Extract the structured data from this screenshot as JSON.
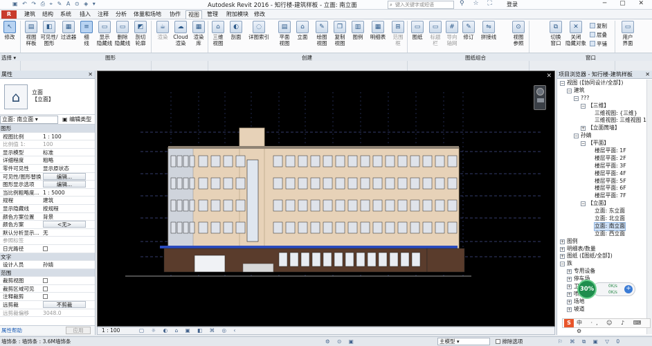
{
  "titlebar": {
    "title": "Autodesk Revit 2016 -   知行楼-建筑样板 - 立面: 南立面",
    "search_placeholder": "键入关键字或短语",
    "login": "登录",
    "window_buttons": "─ ▢ ✕"
  },
  "menubar": {
    "app_button": "R",
    "tabs": [
      "建筑",
      "结构",
      "系统",
      "插入",
      "注释",
      "分析",
      "体量和场地",
      "协作",
      "视图",
      "管理",
      "附加模块",
      "修改"
    ],
    "active_tab": "视图"
  },
  "ribbon": {
    "modify": "修改",
    "buttons": [
      {
        "label": "视图\n样板",
        "icon": "view-template-icon"
      },
      {
        "label": "可见性/\n图形",
        "icon": "visibility-icon"
      },
      {
        "label": "过滤器",
        "icon": "filter-icon"
      },
      {
        "label": "细\n线",
        "icon": "thin-lines-icon"
      },
      {
        "label": "显示\n隐藏线",
        "icon": "show-hidden-icon"
      },
      {
        "label": "删除\n隐藏线",
        "icon": "remove-hidden-icon"
      },
      {
        "label": "剖切\n轮廓",
        "icon": "cut-profile-icon"
      },
      {
        "label": "渲染",
        "icon": "render-icon"
      },
      {
        "label": "Cloud\n渲染",
        "icon": "cloud-render-icon"
      },
      {
        "label": "渲染\n库",
        "icon": "render-gallery-icon"
      },
      {
        "label": "三维\n视图",
        "icon": "3d-view-icon"
      },
      {
        "label": "剖面",
        "icon": "section-icon"
      },
      {
        "label": "详图索引",
        "icon": "callout-icon"
      },
      {
        "label": "平面\n视图",
        "icon": "plan-view-icon"
      },
      {
        "label": "立面",
        "icon": "elevation-icon"
      },
      {
        "label": "绘图\n视图",
        "icon": "drafting-view-icon"
      },
      {
        "label": "复制\n视图",
        "icon": "duplicate-view-icon"
      },
      {
        "label": "图例",
        "icon": "legend-icon"
      },
      {
        "label": "明细表",
        "icon": "schedule-icon"
      },
      {
        "label": "范围\n框",
        "icon": "scope-box-icon"
      },
      {
        "label": "图纸",
        "icon": "sheet-icon"
      },
      {
        "label": "标题\n栏",
        "icon": "title-block-icon"
      },
      {
        "label": "导向\n轴网",
        "icon": "guide-grid-icon"
      },
      {
        "label": "修订",
        "icon": "revisions-icon"
      },
      {
        "label": "拼接线",
        "icon": "matchline-icon"
      },
      {
        "label": "视图\n参照",
        "icon": "view-reference-icon"
      },
      {
        "label": "切换\n窗口",
        "icon": "switch-windows-icon"
      },
      {
        "label": "关闭\n隐藏对象",
        "icon": "close-hidden-icon"
      }
    ],
    "small_buttons": [
      "复制",
      "层叠",
      "平铺"
    ],
    "ui_button": "用户\n界面",
    "panels": [
      "选择 ▾",
      "图形",
      "创建",
      "图纸组合",
      "窗口"
    ]
  },
  "properties": {
    "title": "属性",
    "type_name": "立面",
    "type_sub": "【立面】",
    "type_selector": "立面: 南立面",
    "edit_type": "编辑类型",
    "rows": [
      {
        "k": "图形",
        "v": "",
        "group": true
      },
      {
        "k": "视图比例",
        "v": "1 : 100"
      },
      {
        "k": "比例值 1:",
        "v": "100",
        "gray": true
      },
      {
        "k": "显示模型",
        "v": "标准"
      },
      {
        "k": "详细程度",
        "v": "粗略"
      },
      {
        "k": "零件可见性",
        "v": "显示原状态"
      },
      {
        "k": "可见性/图形替换",
        "v": "编辑...",
        "btn": true
      },
      {
        "k": "图形显示选项",
        "v": "编辑...",
        "btn": true
      },
      {
        "k": "当比例粗略度...",
        "v": "1 : 5000"
      },
      {
        "k": "规程",
        "v": "建筑"
      },
      {
        "k": "显示隐藏线",
        "v": "按规程"
      },
      {
        "k": "颜色方案位置",
        "v": "背景"
      },
      {
        "k": "颜色方案",
        "v": "<无>",
        "btn": true
      },
      {
        "k": "默认分析显示...",
        "v": "无"
      },
      {
        "k": "参照标签",
        "v": "",
        "gray": true
      },
      {
        "k": "日光路径",
        "v": "",
        "check": true
      },
      {
        "k": "文字",
        "v": "",
        "group": true
      },
      {
        "k": "设计人员",
        "v": "孙婧"
      },
      {
        "k": "范围",
        "v": "",
        "group": true
      },
      {
        "k": "裁剪视图",
        "v": "",
        "check": true
      },
      {
        "k": "裁剪区域可见",
        "v": "",
        "check": true
      },
      {
        "k": "注释裁剪",
        "v": "",
        "check": true
      },
      {
        "k": "远剪裁",
        "v": "不剪裁",
        "btn": true
      },
      {
        "k": "远剪裁偏移",
        "v": "3048.0",
        "gray": true
      }
    ],
    "help": "属性帮助",
    "apply": "应用"
  },
  "view": {
    "scale": "1 : 100",
    "controls": "▢ ☼ ◐ ⌂ ▣ ◧ ⌘ ◎ ‹"
  },
  "browser": {
    "title": "项目浏览器 - 知行楼-建筑样板",
    "nodes": [
      {
        "t": "视图 (【协同设计/全部】)",
        "lvl": 0,
        "tg": "−"
      },
      {
        "t": "建筑",
        "lvl": 1,
        "tg": "−"
      },
      {
        "t": "???",
        "lvl": 2,
        "tg": "−"
      },
      {
        "t": "【三维】",
        "lvl": 3,
        "tg": "−"
      },
      {
        "t": "三维视图: {三维}",
        "lvl": 4
      },
      {
        "t": "三维视图: 三维视图 1",
        "lvl": 4
      },
      {
        "t": "【立面筒墙】",
        "lvl": 3,
        "tg": "+"
      },
      {
        "t": "孙婧",
        "lvl": 2,
        "tg": "−"
      },
      {
        "t": "【平面】",
        "lvl": 3,
        "tg": "−"
      },
      {
        "t": "楼层平面: 1F",
        "lvl": 4
      },
      {
        "t": "楼层平面: 2F",
        "lvl": 4
      },
      {
        "t": "楼层平面: 3F",
        "lvl": 4
      },
      {
        "t": "楼层平面: 4F",
        "lvl": 4
      },
      {
        "t": "楼层平面: 5F",
        "lvl": 4
      },
      {
        "t": "楼层平面: 6F",
        "lvl": 4
      },
      {
        "t": "楼层平面: 7F",
        "lvl": 4
      },
      {
        "t": "【立面】",
        "lvl": 3,
        "tg": "−"
      },
      {
        "t": "立面: 东立面",
        "lvl": 4
      },
      {
        "t": "立面: 北立面",
        "lvl": 4
      },
      {
        "t": "立面: 南立面",
        "lvl": 4,
        "hl": true
      },
      {
        "t": "立面: 西立面",
        "lvl": 4
      },
      {
        "t": "图例",
        "lvl": 0,
        "tg": "+"
      },
      {
        "t": "明细表/数量",
        "lvl": 0,
        "tg": "+"
      },
      {
        "t": "图纸 (【图纸/全部】)",
        "lvl": 0,
        "tg": "+"
      },
      {
        "t": "族",
        "lvl": 0,
        "tg": "−"
      },
      {
        "t": "专用设备",
        "lvl": 1,
        "tg": "+"
      },
      {
        "t": "停车场",
        "lvl": 1,
        "tg": "+"
      },
      {
        "t": "卫浴",
        "lvl": 1,
        "tg": "+"
      },
      {
        "t": "喷头",
        "lvl": 1,
        "tg": "+"
      },
      {
        "t": "场地",
        "lvl": 1,
        "tg": "+"
      },
      {
        "t": "坡道",
        "lvl": 1,
        "tg": "+"
      }
    ]
  },
  "speed_widget": {
    "percent": "30%",
    "up": "0K/s",
    "down": "0K/s",
    "plus": "+"
  },
  "ime": {
    "logo": "S",
    "icons": "中 ·, ☺ ♪ ⌨ ⚙"
  },
  "status": {
    "text": "墙饰条 : 墙饰条 : 3.6M墙饰条",
    "model": "主模型",
    "exclude": "排除选项"
  },
  "colors": {
    "accent": "#4a82c2",
    "facade": "#e7d2b8",
    "roof_blue": "#2a4bbf"
  }
}
